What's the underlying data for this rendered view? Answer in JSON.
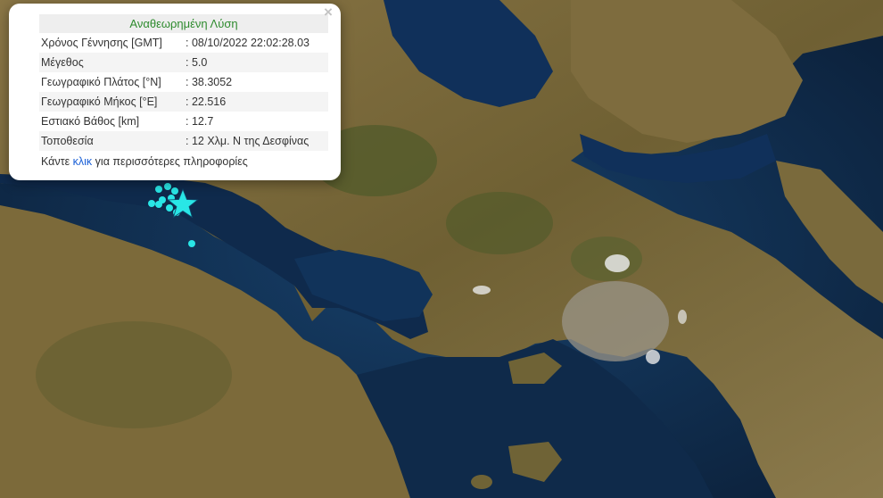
{
  "popup": {
    "title": "Αναθεωρημένη Λύση",
    "close": "×",
    "rows": [
      {
        "label": "Χρόνος Γέννησης [GMT]",
        "value": ": 08/10/2022 22:02:28.03"
      },
      {
        "label": "Μέγεθος",
        "value": ": 5.0"
      },
      {
        "label": "Γεωγραφικό Πλάτος [°N]",
        "value": ": 38.3052"
      },
      {
        "label": "Γεωγραφικό Μήκος [°E]",
        "value": ": 22.516"
      },
      {
        "label": "Εστιακό Βάθος [km]",
        "value": ": 12.7"
      },
      {
        "label": "Τοποθεσία",
        "value": ": 12 Χλμ. Ν της Δεσφίνας"
      }
    ],
    "footer_prefix": "Κάντε ",
    "footer_link": "κλικ",
    "footer_suffix": " για περισσότερες πληροφορίες"
  },
  "map": {
    "colors": {
      "sea": "#0d2440",
      "sea_light": "#1b4a6e",
      "land": "#7b6a3e",
      "land_green": "#4f5a2a",
      "urban": "#9a9488",
      "marker": "#29e6e6"
    },
    "epicenter_icon": "star-icon",
    "aftershock_icon": "circle-icon"
  }
}
